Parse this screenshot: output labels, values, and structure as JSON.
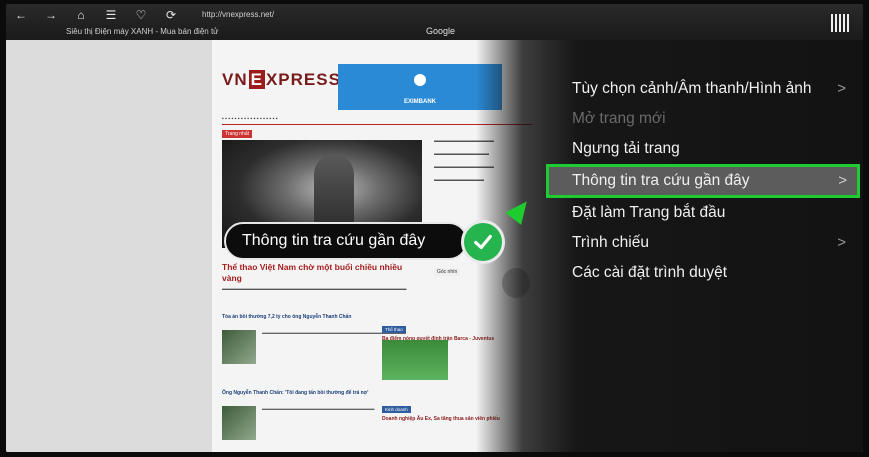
{
  "browser": {
    "url": "http://vnexpress.net/",
    "tab_title": "Siêu thị Điện máy XANH - Mua bán điện tử",
    "search_tab": "Google",
    "nav_icons": [
      "arrow-left-icon",
      "arrow-right-icon",
      "home-icon",
      "bookmark-icon",
      "heart-icon",
      "refresh-icon"
    ]
  },
  "menu": {
    "items": [
      {
        "label": "Tùy chọn cảnh/Âm thanh/Hình ảnh",
        "has_submenu": true,
        "enabled": true,
        "selected": false
      },
      {
        "label": "Mở trang mới",
        "has_submenu": false,
        "enabled": false,
        "selected": false
      },
      {
        "label": "Ngưng tải trang",
        "has_submenu": false,
        "enabled": true,
        "selected": false
      },
      {
        "label": "Thông tin tra cứu gần đây",
        "has_submenu": true,
        "enabled": true,
        "selected": true
      },
      {
        "label": "Đặt làm Trang bắt đầu",
        "has_submenu": false,
        "enabled": true,
        "selected": false
      },
      {
        "label": "Trình chiếu",
        "has_submenu": true,
        "enabled": true,
        "selected": false
      },
      {
        "label": "Các cài đặt trình duyệt",
        "has_submenu": false,
        "enabled": true,
        "selected": false
      }
    ],
    "arrow_glyph": ">"
  },
  "callout": {
    "label": "Thông tin tra cứu gần đây"
  },
  "webpage": {
    "logo_prefix": "VN",
    "logo_mark": "E",
    "logo_suffix": "XPRESS",
    "ad_label": "EXIMBANK",
    "headline": "Thể thao Việt Nam chờ một buổi chiều nhiều vàng",
    "story1_title": "Tòa án bồi thường 7,2 tỷ cho ông Nguyễn Thanh Chấn",
    "story2_title": "Ông Nguyễn Thanh Chấn: 'Tôi đang tấn bồi thường để trả nợ'",
    "right1_title": "Ba điểm nóng quyết định trận Barca - Juventus",
    "right1_tab": "Thể thao",
    "right2_title": "Doanh nghiệp Âu Ex, Sa tăng thua sân viên phiếu",
    "right2_tab": "Kinh doanh",
    "side_box_label": "Góc nhìn",
    "section_tag": "Trang nhất"
  },
  "colors": {
    "selection_border": "#1fcc2f",
    "check_badge": "#25b44e",
    "menu_text": "#f0f0f0",
    "menu_disabled": "#6a6a6a"
  }
}
